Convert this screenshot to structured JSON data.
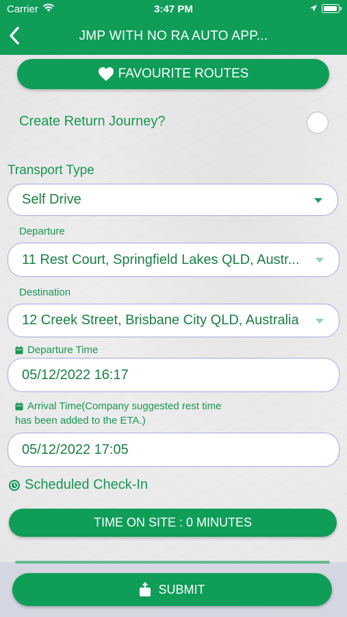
{
  "status_bar": {
    "carrier": "Carrier",
    "time": "3:47 PM"
  },
  "nav": {
    "title": "JMP WITH NO RA AUTO APP..."
  },
  "favourite_routes_label": "FAVOURITE ROUTES",
  "return_journey": {
    "label": "Create Return Journey?",
    "enabled": false
  },
  "transport": {
    "label": "Transport Type",
    "value": "Self Drive"
  },
  "departure": {
    "label": "Departure",
    "value": "11 Rest Court, Springfield Lakes QLD, Austr..."
  },
  "destination": {
    "label": "Destination",
    "value": "12 Creek Street, Brisbane City QLD, Australia"
  },
  "departure_time": {
    "label": "Departure Time",
    "value": "05/12/2022 16:17"
  },
  "arrival_time": {
    "label_line1": "Arrival Time(Company suggested rest time",
    "label_line2": "has been added to the ETA.)",
    "value": "05/12/2022 17:05"
  },
  "scheduled_checkin_label": "Scheduled Check-In",
  "time_on_site_label": "TIME ON SITE : 0 MINUTES",
  "submit_label": "SUBMIT",
  "colors": {
    "brand_green": "#0f9d58",
    "label_green": "#179653",
    "field_border": "#a5a6e0"
  },
  "icons": {
    "back": "chevron-left-icon",
    "favourite": "heart-icon",
    "calendar": "calendar-icon",
    "checkin": "clock-icon",
    "submit": "share-icon"
  }
}
